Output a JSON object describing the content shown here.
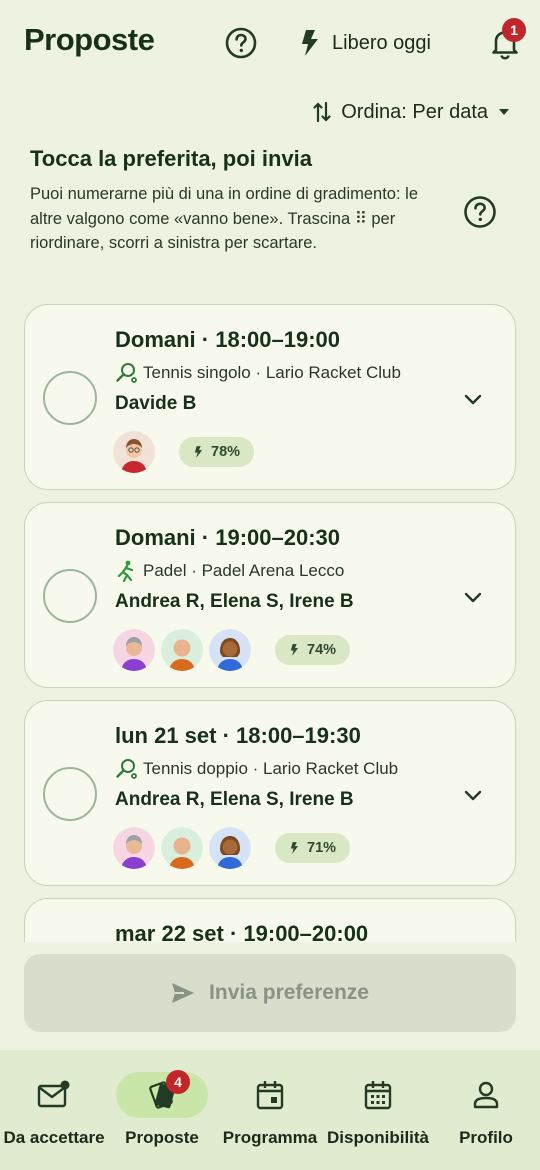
{
  "header": {
    "title": "Proposte",
    "help_icon": "help-circle-icon",
    "free_today_label": "Libero oggi",
    "notification_count": "1"
  },
  "sort": {
    "label": "Ordina: Per data"
  },
  "intro": {
    "title": "Tocca la preferita, poi invia",
    "text": "Puoi numerarne più di una in ordine di gradimento: le altre valgono come «vanno bene». Trascina ⠿ per riordinare, scorri a sinistra per scartare."
  },
  "proposals": [
    {
      "time": "Domani · 18:00–19:00",
      "sport_icon": "tennis-icon",
      "details": "Tennis singolo · Lario Racket Club",
      "people": "Davide B",
      "avatars": [
        "avatar-red-shirt"
      ],
      "score": "78%"
    },
    {
      "time": "Domani · 19:00–20:30",
      "sport_icon": "padel-icon",
      "details": "Padel · Padel Arena Lecco",
      "people": "Andrea R, Elena S, Irene B",
      "avatars": [
        "avatar-purple",
        "avatar-orange",
        "avatar-blue"
      ],
      "score": "74%"
    },
    {
      "time": "lun 21 set · 18:00–19:30",
      "sport_icon": "tennis-icon",
      "details": "Tennis doppio · Lario Racket Club",
      "people": "Andrea R, Elena S, Irene B",
      "avatars": [
        "avatar-purple",
        "avatar-orange",
        "avatar-blue"
      ],
      "score": "71%"
    },
    {
      "time": "mar 22 set · 19:00–20:00"
    }
  ],
  "send_button": {
    "label": "Invia preferenze"
  },
  "nav": {
    "items": [
      {
        "label": "Da accettare",
        "icon": "mail-icon"
      },
      {
        "label": "Proposte",
        "icon": "cards-icon",
        "badge": "4",
        "active": true
      },
      {
        "label": "Programma",
        "icon": "calendar-icon"
      },
      {
        "label": "Disponibilità",
        "icon": "calendar-grid-icon"
      },
      {
        "label": "Profilo",
        "icon": "person-icon"
      }
    ]
  },
  "colors": {
    "background": "#edf3e0",
    "accent": "#c9e6a8",
    "badge": "#c0262a",
    "card": "#f7f9ec"
  }
}
